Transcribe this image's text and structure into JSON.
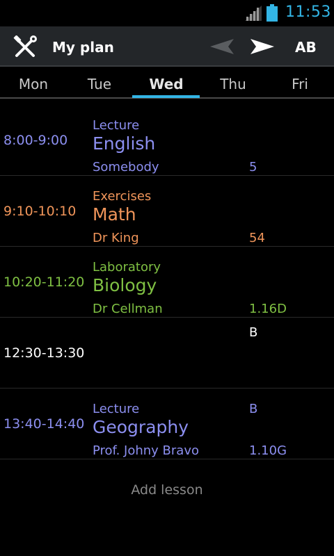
{
  "status_bar": {
    "time": "11:53",
    "icons": [
      "signal-icon",
      "battery-icon"
    ],
    "accent": "#33b5e5"
  },
  "action_bar": {
    "title": "My plan",
    "week": "AB",
    "icons": [
      "tools-icon",
      "previous-arrow-icon",
      "next-arrow-icon"
    ]
  },
  "tabs": [
    {
      "label": "Mon"
    },
    {
      "label": "Tue"
    },
    {
      "label": "Wed",
      "selected": true
    },
    {
      "label": "Thu"
    },
    {
      "label": "Fri"
    }
  ],
  "lessons": [
    {
      "time": "8:00-9:00",
      "type": "Lecture",
      "subject": "English",
      "teacher": "Somebody",
      "group": "",
      "room": "5",
      "color": "#8c8ff0"
    },
    {
      "time": "9:10-10:10",
      "type": "Exercises",
      "subject": "Math",
      "teacher": "Dr King",
      "group": "",
      "room": "54",
      "color": "#f0955a"
    },
    {
      "time": "10:20-11:20",
      "type": "Laboratory",
      "subject": "Biology",
      "teacher": "Dr Cellman",
      "group": "",
      "room": "1.16D",
      "color": "#7fc043"
    },
    {
      "time": "12:30-13:30",
      "type": "",
      "subject": "",
      "teacher": "",
      "group": "B",
      "room": "",
      "color": "#ffffff"
    },
    {
      "time": "13:40-14:40",
      "type": "Lecture",
      "subject": "Geography",
      "teacher": "Prof. Johny Bravo",
      "group": "B",
      "room": "1.10G",
      "color": "#8c8ff0"
    }
  ],
  "footer": {
    "add_lesson": "Add lesson"
  }
}
